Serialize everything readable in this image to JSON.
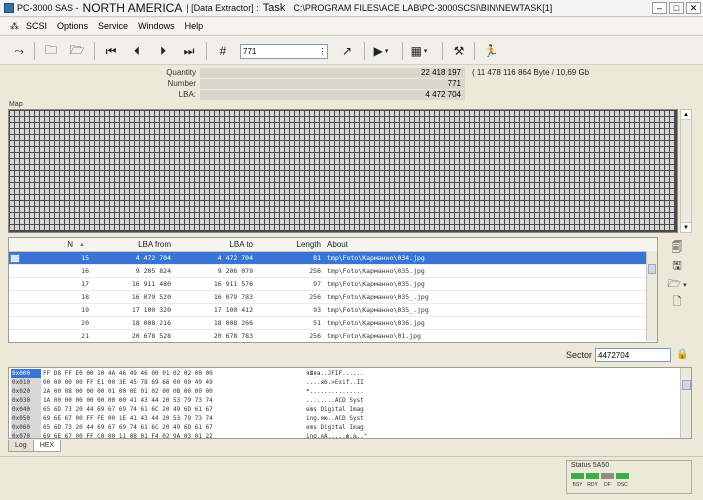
{
  "window": {
    "title_prefix": "PC-3000 SAS -",
    "region": "NORTH AMERICA",
    "module": "| [Data Extractor] :",
    "task_label": "Task",
    "path": "C:\\PROGRAM FILES\\ACE LAB\\PC-3000SCSI\\BIN\\NEWTASK[1]",
    "minimize": "–",
    "maximize": "□",
    "close": "✕"
  },
  "menu": {
    "icon": "⁂",
    "items": [
      "SCSI",
      "Options",
      "Service",
      "Windows",
      "Help"
    ]
  },
  "toolbar": {
    "input_value": "771",
    "input_button": "⋮"
  },
  "stats": {
    "quantity_label": "Quantity",
    "quantity_value": "22 418 197",
    "quantity_extra": "( 11 478 116 864 Byte / 10,69 Gb",
    "number_label": "Number",
    "number_value": "771",
    "lba_label": "LBA:",
    "lba_value": "4 472 704"
  },
  "map": {
    "label": "Map",
    "scroll_up": "▲",
    "scroll_down": "▼"
  },
  "file_table": {
    "columns": {
      "n": "N",
      "sort": "▲",
      "lba_from": "LBA from",
      "lba_to": "LBA to",
      "length": "Length",
      "about": "About"
    },
    "rows": [
      {
        "n": "15",
        "lba_from": "4 472 704",
        "lba_to": "4 472 704",
        "length": "81",
        "about": "tmp\\Foto\\Карманно\\034.jpg"
      },
      {
        "n": "16",
        "lba_from": "9 205 824",
        "lba_to": "9 206 079",
        "length": "256",
        "about": "tmp\\Foto\\Карманно\\035.jpg"
      },
      {
        "n": "17",
        "lba_from": "16 911 480",
        "lba_to": "16 911 576",
        "length": "97",
        "about": "tmp\\Foto\\Карманно\\035.jpg"
      },
      {
        "n": "18",
        "lba_from": "16 079 520",
        "lba_to": "16 079 783",
        "length": "256",
        "about": "tmp\\Foto\\Карманно\\035_.jpg"
      },
      {
        "n": "19",
        "lba_from": "17 100 320",
        "lba_to": "17 100 412",
        "length": "93",
        "about": "tmp\\Foto\\Карманно\\035_.jpg"
      },
      {
        "n": "20",
        "lba_from": "18 008 216",
        "lba_to": "18 008 266",
        "length": "51",
        "about": "tmp\\Foto\\Карманно\\036.jpg"
      },
      {
        "n": "21",
        "lba_from": "20 678 528",
        "lba_to": "20 678 783",
        "length": "256",
        "about": "tmp\\Foto\\Карманно\\01.jpg"
      }
    ]
  },
  "sector": {
    "label": "Sector",
    "value": "4472704"
  },
  "hex": {
    "rows": [
      {
        "addr": "0x000",
        "bytes": "FF D8 FF E0 00 10 4A 46 49 46 00 01 02 02 00 00",
        "ascii": "яШяа..JFIF......"
      },
      {
        "addr": "0x010",
        "bytes": "00 00 00 00 FF E1 00 3E 45 78 69 66 00 00 49 49",
        "ascii": "....яб.>Exif..II"
      },
      {
        "addr": "0x020",
        "bytes": "2A 00 08 00 00 00 01 00 0E 01 02 00 0B 00 00 00",
        "ascii": "*..............."
      },
      {
        "addr": "0x030",
        "bytes": "1A 00 00 00 00 00 00 00 41 43 44 20 53 79 73 74",
        "ascii": "........ACD Syst"
      },
      {
        "addr": "0x040",
        "bytes": "65 6D 73 20 44 69 67 69 74 61 6C 20 49 6D 61 67",
        "ascii": "ems Digital Imag"
      },
      {
        "addr": "0x050",
        "bytes": "69 6E 67 00 FF FE 00 1E 41 43 44 20 53 79 73 74",
        "ascii": "ing.яю..ACD Syst"
      },
      {
        "addr": "0x060",
        "bytes": "65 6D 73 20 44 69 67 69 74 61 6C 20 49 6D 61 67",
        "ascii": "ems Digital Imag"
      },
      {
        "addr": "0x070",
        "bytes": "69 6E 67 00 FF C0 00 11 08 01 F4 02 9A 03 01 22",
        "ascii": "ing.яА.....ф.љ..\""
      }
    ]
  },
  "tabs": [
    "Log",
    "HEX"
  ],
  "status": {
    "title": "Status 5A50",
    "leds": [
      "BSY",
      "RDY",
      "DF",
      "DSC"
    ]
  },
  "colors": {
    "map_background": "#4a4a4a",
    "map_cell": "#d6d6d6",
    "selection": "#3875d7"
  }
}
